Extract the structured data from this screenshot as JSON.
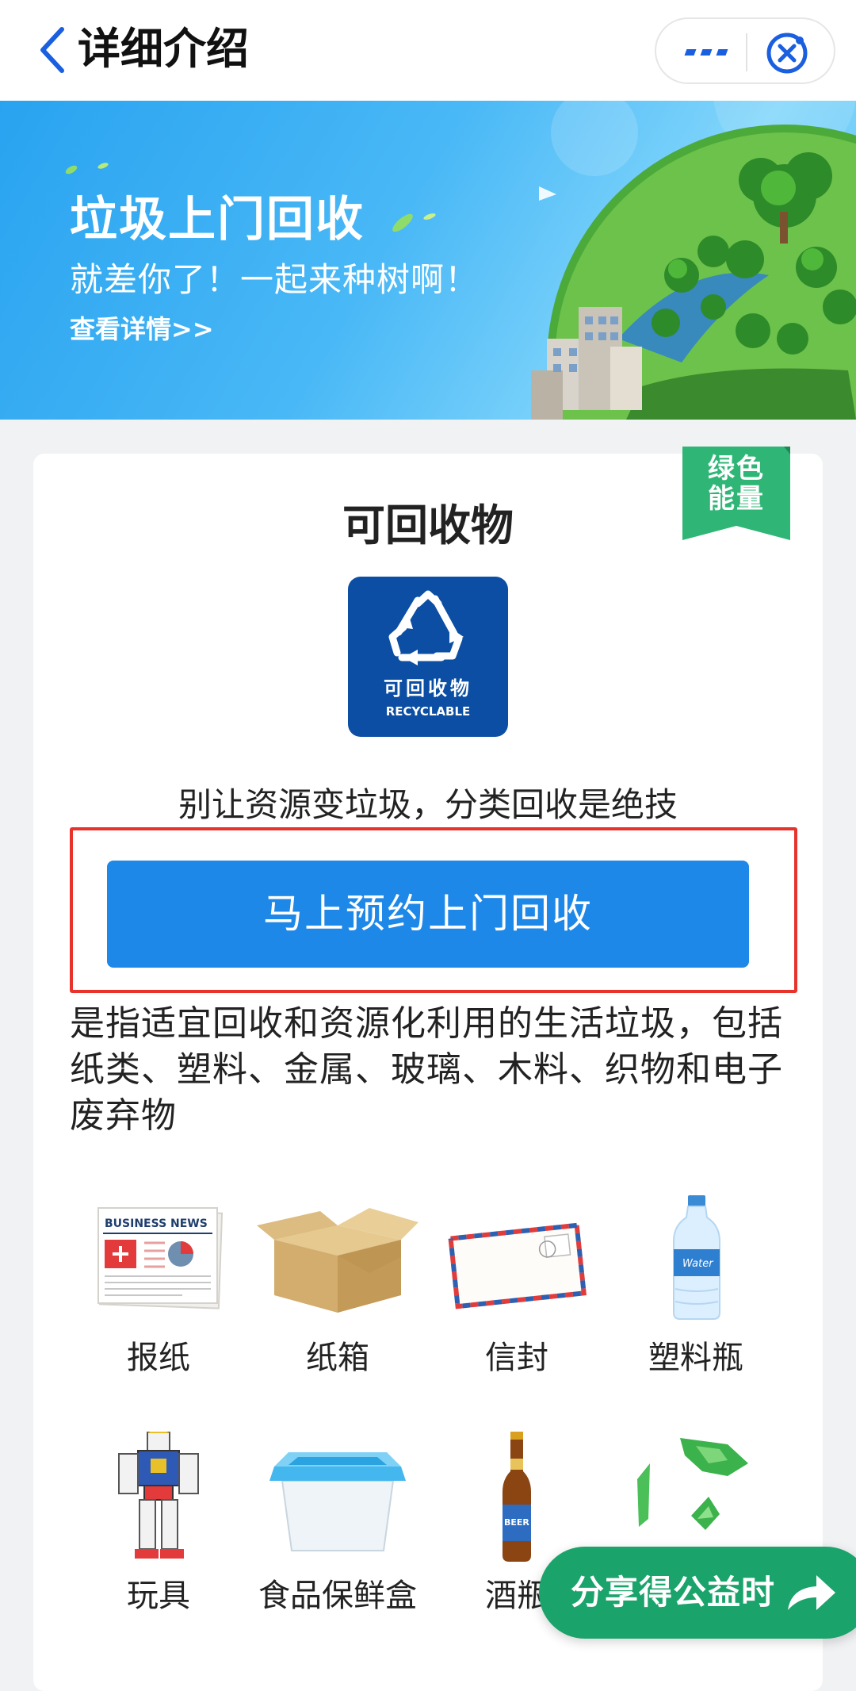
{
  "header": {
    "title": "详细介绍",
    "back_icon": "chevron-left-icon",
    "more_icon": "more-dots-icon",
    "close_icon": "close-mini-program-icon",
    "accent_color": "#1a5fe0"
  },
  "banner": {
    "title": "垃圾上门回收",
    "subtitle": "就差你了！一起来种树啊！",
    "link": "查看详情>>"
  },
  "card": {
    "tag": "绿色能量",
    "tag_line1": "绿色",
    "tag_line2": "能量",
    "title": "可回收物",
    "icon": {
      "label_cn": "可回收物",
      "label_en": "RECYCLABLE",
      "color": "#0b4ea3"
    },
    "slogan": "别让资源变垃圾，分类回收是绝技",
    "book_button": "马上预约上门回收",
    "description": "是指适宜回收和资源化利用的生活垃圾，包括纸类、塑料、金属、玻璃、木料、织物和电子废弃物"
  },
  "items": [
    {
      "name": "报纸",
      "icon": "newspaper-icon",
      "text": "BUSINESS NEWS"
    },
    {
      "name": "纸箱",
      "icon": "cardboard-box-icon"
    },
    {
      "name": "信封",
      "icon": "envelope-icon"
    },
    {
      "name": "塑料瓶",
      "icon": "plastic-bottle-icon",
      "text": "Water"
    },
    {
      "name": "玩具",
      "icon": "toy-robot-icon"
    },
    {
      "name": "食品保鲜盒",
      "icon": "food-container-icon"
    },
    {
      "name": "酒瓶",
      "icon": "beer-bottle-icon",
      "text": "BEER"
    },
    {
      "name": "",
      "icon": "broken-glass-icon"
    }
  ],
  "share": {
    "label": "分享得公益时",
    "icon": "share-arrow-icon",
    "color": "#1aa36b"
  }
}
